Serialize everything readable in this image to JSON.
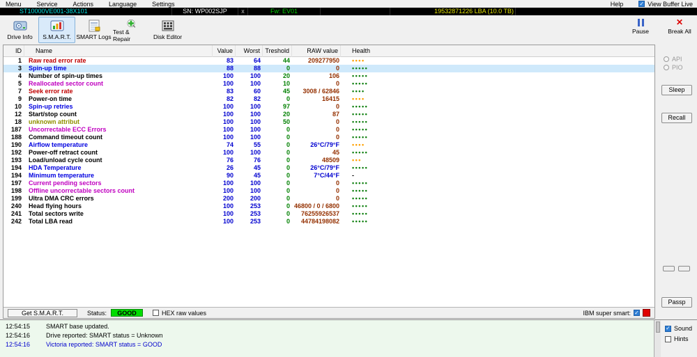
{
  "colors": {
    "status_good_bg": "#00dd00",
    "health_green": "#108010",
    "health_orange": "#ffa000",
    "value_blue": "#0000d0",
    "treshold_green": "#008000",
    "raw_maroon": "#943000",
    "name_red": "#c00000",
    "name_blue": "#0000e0",
    "name_magenta": "#c000c0",
    "name_olive": "#909000",
    "model_cyan": "#00e0e0",
    "firmware_green": "#00d000",
    "capacity_yellow": "#e0e000",
    "selected_row_bg": "#cfe9fb"
  },
  "menubar": {
    "items": [
      "Menu",
      "Service",
      "Actions",
      "Language",
      "Settings"
    ],
    "help": "Help",
    "view_buffer_live": "View Buffer Live"
  },
  "drivebar": {
    "model": "ST10000VE001-38X101",
    "serial": "SN: WP002SJP",
    "close": "x",
    "firmware": "Fw: EV01",
    "capacity": "19532871226 LBA (10.0 TB)"
  },
  "toolbar": {
    "buttons": [
      {
        "label": "Drive Info",
        "selected": false
      },
      {
        "label": "S.M.A.R.T.",
        "selected": true
      },
      {
        "label": "SMART Logs",
        "selected": false
      },
      {
        "label": "Test & Repair",
        "selected": false
      },
      {
        "label": "Disk Editor",
        "selected": false
      }
    ],
    "pause": "Pause",
    "break_all": "Break All"
  },
  "table": {
    "headers": [
      "ID",
      "Name",
      "Value",
      "Worst",
      "Treshold",
      "RAW value",
      "Health"
    ],
    "rows": [
      {
        "id": "1",
        "name": "Raw read error rate",
        "name_color": "red",
        "value": "83",
        "worst": "64",
        "treshold": "44",
        "raw": "209277950",
        "raw_color": "maroon",
        "health": {
          "dots": 4,
          "color": "orange"
        }
      },
      {
        "id": "3",
        "name": "Spin-up time",
        "name_color": "blue",
        "value": "88",
        "worst": "88",
        "treshold": "0",
        "raw": "0",
        "raw_color": "maroon",
        "health": {
          "dots": 5,
          "color": "green"
        },
        "selected": true
      },
      {
        "id": "4",
        "name": "Number of spin-up times",
        "name_color": "black",
        "value": "100",
        "worst": "100",
        "treshold": "20",
        "raw": "106",
        "raw_color": "maroon",
        "health": {
          "dots": 5,
          "color": "green"
        }
      },
      {
        "id": "5",
        "name": "Reallocated sector count",
        "name_color": "magenta",
        "value": "100",
        "worst": "100",
        "treshold": "10",
        "raw": "0",
        "raw_color": "maroon",
        "health": {
          "dots": 5,
          "color": "green"
        }
      },
      {
        "id": "7",
        "name": "Seek error rate",
        "name_color": "red",
        "value": "83",
        "worst": "60",
        "treshold": "45",
        "raw": "3008 / 62846",
        "raw_color": "maroon",
        "health": {
          "dots": 4,
          "color": "green"
        }
      },
      {
        "id": "9",
        "name": "Power-on time",
        "name_color": "black",
        "value": "82",
        "worst": "82",
        "treshold": "0",
        "raw": "16415",
        "raw_color": "maroon",
        "health": {
          "dots": 4,
          "color": "orange"
        }
      },
      {
        "id": "10",
        "name": "Spin-up retries",
        "name_color": "blue",
        "value": "100",
        "worst": "100",
        "treshold": "97",
        "raw": "0",
        "raw_color": "maroon",
        "health": {
          "dots": 5,
          "color": "green"
        }
      },
      {
        "id": "12",
        "name": "Start/stop count",
        "name_color": "black",
        "value": "100",
        "worst": "100",
        "treshold": "20",
        "raw": "87",
        "raw_color": "maroon",
        "health": {
          "dots": 5,
          "color": "green"
        }
      },
      {
        "id": "18",
        "name": "unknown attribut",
        "name_color": "olive",
        "value": "100",
        "worst": "100",
        "treshold": "50",
        "raw": "0",
        "raw_color": "maroon",
        "health": {
          "dots": 5,
          "color": "green"
        }
      },
      {
        "id": "187",
        "name": "Uncorrectable ECC Errors",
        "name_color": "magenta",
        "value": "100",
        "worst": "100",
        "treshold": "0",
        "raw": "0",
        "raw_color": "maroon",
        "health": {
          "dots": 5,
          "color": "green"
        }
      },
      {
        "id": "188",
        "name": "Command timeout count",
        "name_color": "black",
        "value": "100",
        "worst": "100",
        "treshold": "0",
        "raw": "0",
        "raw_color": "maroon",
        "health": {
          "dots": 5,
          "color": "green"
        }
      },
      {
        "id": "190",
        "name": "Airflow temperature",
        "name_color": "blue",
        "value": "74",
        "worst": "55",
        "treshold": "0",
        "raw": "26°C/79°F",
        "raw_color": "blue",
        "health": {
          "dots": 4,
          "color": "orange"
        }
      },
      {
        "id": "192",
        "name": "Power-off retract count",
        "name_color": "black",
        "value": "100",
        "worst": "100",
        "treshold": "0",
        "raw": "45",
        "raw_color": "maroon",
        "health": {
          "dots": 5,
          "color": "green"
        }
      },
      {
        "id": "193",
        "name": "Load/unload cycle count",
        "name_color": "black",
        "value": "76",
        "worst": "76",
        "treshold": "0",
        "raw": "48509",
        "raw_color": "maroon",
        "health": {
          "dots": 3,
          "color": "orange"
        }
      },
      {
        "id": "194",
        "name": "HDA Temperature",
        "name_color": "blue",
        "value": "26",
        "worst": "45",
        "treshold": "0",
        "raw": "26°C/79°F",
        "raw_color": "blue",
        "health": {
          "dots": 5,
          "color": "green"
        }
      },
      {
        "id": "194",
        "name": "Minimum temperature",
        "name_color": "blue",
        "value": "90",
        "worst": "45",
        "treshold": "0",
        "raw": "7°C/44°F",
        "raw_color": "blue",
        "health": {
          "text": "-"
        }
      },
      {
        "id": "197",
        "name": "Current pending sectors",
        "name_color": "magenta",
        "value": "100",
        "worst": "100",
        "treshold": "0",
        "raw": "0",
        "raw_color": "maroon",
        "health": {
          "dots": 5,
          "color": "green"
        }
      },
      {
        "id": "198",
        "name": "Offline uncorrectable sectors count",
        "name_color": "magenta",
        "value": "100",
        "worst": "100",
        "treshold": "0",
        "raw": "0",
        "raw_color": "maroon",
        "health": {
          "dots": 5,
          "color": "green"
        }
      },
      {
        "id": "199",
        "name": "Ultra DMA CRC errors",
        "name_color": "black",
        "value": "200",
        "worst": "200",
        "treshold": "0",
        "raw": "0",
        "raw_color": "maroon",
        "health": {
          "dots": 5,
          "color": "green"
        }
      },
      {
        "id": "240",
        "name": "Head flying hours",
        "name_color": "black",
        "value": "100",
        "worst": "253",
        "treshold": "0",
        "raw": "46800 / 0 / 6800",
        "raw_color": "maroon",
        "health": {
          "dots": 5,
          "color": "green"
        }
      },
      {
        "id": "241",
        "name": "Total sectors write",
        "name_color": "black",
        "value": "100",
        "worst": "253",
        "treshold": "0",
        "raw": "76255926537",
        "raw_color": "maroon",
        "health": {
          "dots": 5,
          "color": "green"
        }
      },
      {
        "id": "242",
        "name": "Total LBA read",
        "name_color": "black",
        "value": "100",
        "worst": "253",
        "treshold": "0",
        "raw": "44784198082",
        "raw_color": "maroon",
        "health": {
          "dots": 5,
          "color": "green"
        }
      }
    ]
  },
  "sidebar": {
    "api": "API",
    "pio": "PIO",
    "sleep": "Sleep",
    "recall": "Recall",
    "passp": "Passp"
  },
  "statusbar": {
    "get_smart": "Get S.M.A.R.T.",
    "status_label": "Status:",
    "status_value": "GOOD",
    "hex_label": "HEX raw values",
    "ibm_label": "IBM super smart:"
  },
  "log": {
    "entries": [
      {
        "time": "12:54:15",
        "text": "SMART base updated.",
        "color": "black"
      },
      {
        "time": "12:54:16",
        "text": "Drive reported: SMART status = Unknown",
        "color": "black"
      },
      {
        "time": "12:54:16",
        "text": "Victoria reported: SMART status = GOOD",
        "color": "blue"
      }
    ]
  },
  "options": {
    "sound": "Sound",
    "hints": "Hints"
  }
}
